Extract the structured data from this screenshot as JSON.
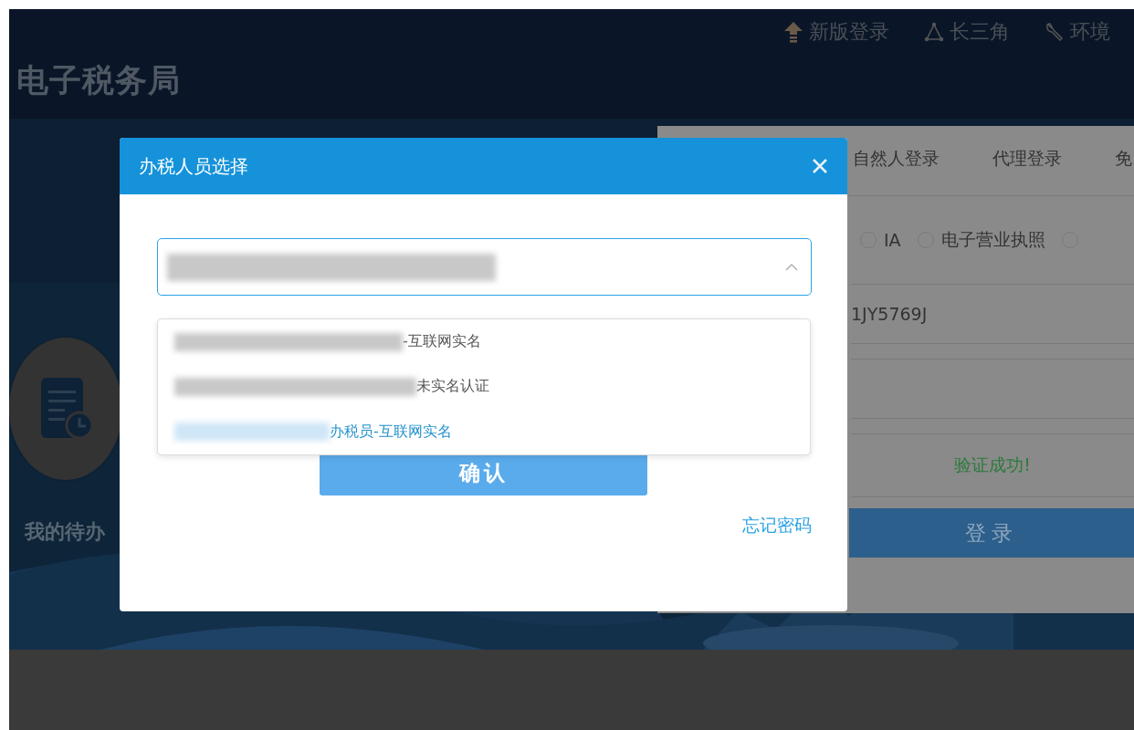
{
  "header": {
    "logo": "电子税务局",
    "nav": [
      {
        "label": "新版登录"
      },
      {
        "label": "长三角"
      },
      {
        "label": "环境"
      }
    ]
  },
  "todo": {
    "label": "我的待办"
  },
  "login_panel": {
    "tabs": [
      {
        "label": "自然人登录",
        "selected": false
      },
      {
        "label": "代理登录",
        "selected": false
      },
      {
        "label": "免",
        "selected": false
      }
    ],
    "radios": [
      {
        "label": "IA",
        "selected": false
      },
      {
        "label": "电子营业执照",
        "selected": false
      },
      {
        "selected": false
      }
    ],
    "account": {
      "value": "1JY5769J"
    },
    "status": "验证成功!",
    "login_button": "登录"
  },
  "modal": {
    "title": "办税人员选择",
    "select": {
      "expanded": true
    },
    "options": [
      {
        "suffix": "-互联网实名",
        "selected": false
      },
      {
        "suffix": "未实名认证",
        "selected": false
      },
      {
        "suffix": "办税员-互联网实名",
        "selected": true
      }
    ],
    "confirm_button": "确认",
    "forgot_link": "忘记密码"
  }
}
